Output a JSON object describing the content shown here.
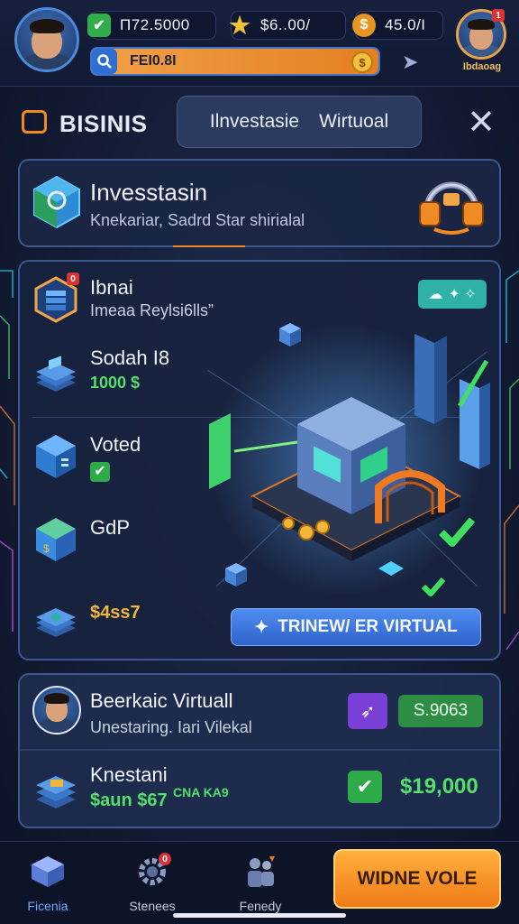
{
  "hud": {
    "currency_green": "Π72.5000",
    "currency_star": "$6..00/",
    "currency_coin": "45.0/I",
    "search_value": "FEI0.8I",
    "player_name": "Ibdaoag",
    "player_badge": "1"
  },
  "header": {
    "section_title": "BISINIS",
    "tab_left": "Ilnvestasie",
    "tab_right": "Wirtuoal"
  },
  "invest_card": {
    "title": "Invesstasin",
    "subtitle": "Knekariar, Sadrd Star shirialal"
  },
  "main_card": {
    "items": [
      {
        "title": "Ibnai",
        "subtitle": "Imeaa Reylsi6lls”",
        "badge": "0"
      },
      {
        "title": "Sodah I8",
        "subtitle": "1000 $"
      },
      {
        "title": "Voted",
        "subtitle": "✔"
      },
      {
        "title": "GdP",
        "subtitle": ""
      },
      {
        "title": "",
        "subtitle": "$4ss7"
      }
    ],
    "chip_value": "✦ ✧",
    "trainer_label": "TRINEW/ ER VIRTUAL"
  },
  "bottom_card": {
    "row1_title": "Beerkaic Virtuall",
    "row1_sub": "Unestaring. Iari Vilekal",
    "row1_value": "S.9063",
    "row2_title": "Knestani",
    "row2_sub": "$aun $67",
    "row2_small": "CNA KA9",
    "row2_value": "$19,000"
  },
  "nav": {
    "item1": "Ficenia",
    "item2": "Stenees",
    "item3": "Fenedy",
    "item2_badge": "0",
    "cta": "WIDNE VOLE"
  }
}
